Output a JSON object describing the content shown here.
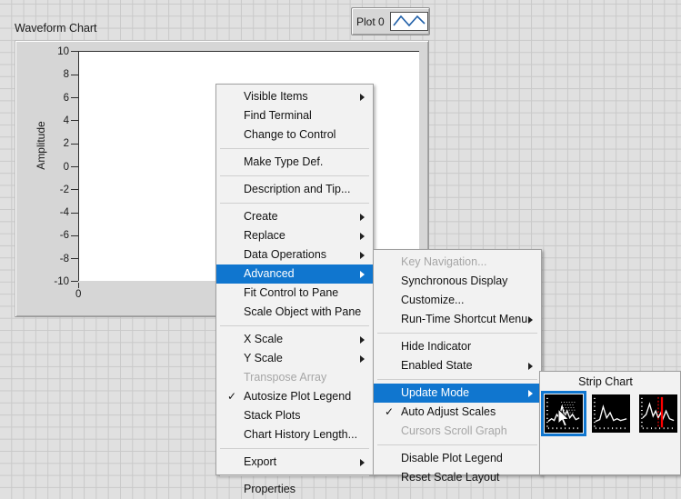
{
  "chart": {
    "label": "Waveform Chart",
    "y_axis_title": "Amplitude",
    "y_ticks": [
      "10",
      "8",
      "6",
      "4",
      "2",
      "0",
      "-2",
      "-4",
      "-6",
      "-8",
      "-10"
    ],
    "x_ticks": [
      "0"
    ],
    "plot_background": "#ffffff",
    "frame_background": "#d6d6d6"
  },
  "plot_legend": {
    "label": "Plot 0",
    "swatch_icon": "waveform-line-icon",
    "line_color": "#1f5fa8"
  },
  "context_menu": {
    "items": [
      {
        "label": "Visible Items",
        "submenu": true
      },
      {
        "label": "Find Terminal",
        "submenu": false
      },
      {
        "label": "Change to Control",
        "submenu": false
      },
      {
        "separator": true
      },
      {
        "label": "Make Type Def.",
        "submenu": false
      },
      {
        "separator": true
      },
      {
        "label": "Description and Tip...",
        "submenu": false
      },
      {
        "separator": true
      },
      {
        "label": "Create",
        "submenu": true
      },
      {
        "label": "Replace",
        "submenu": true
      },
      {
        "label": "Data Operations",
        "submenu": true
      },
      {
        "label": "Advanced",
        "submenu": true,
        "highlighted": true
      },
      {
        "label": "Fit Control to Pane",
        "submenu": false
      },
      {
        "label": "Scale Object with Pane",
        "submenu": false
      },
      {
        "separator": true
      },
      {
        "label": "X Scale",
        "submenu": true
      },
      {
        "label": "Y Scale",
        "submenu": true
      },
      {
        "label": "Transpose Array",
        "submenu": false,
        "disabled": true
      },
      {
        "label": "Autosize Plot Legend",
        "submenu": false,
        "checked": true
      },
      {
        "label": "Stack Plots",
        "submenu": false
      },
      {
        "label": "Chart History Length...",
        "submenu": false
      },
      {
        "separator": true
      },
      {
        "label": "Export",
        "submenu": true
      },
      {
        "separator": true
      },
      {
        "label": "Properties",
        "submenu": false
      }
    ]
  },
  "advanced_submenu": {
    "items": [
      {
        "label": "Key Navigation...",
        "submenu": false,
        "disabled": true
      },
      {
        "label": "Synchronous Display",
        "submenu": false
      },
      {
        "label": "Customize...",
        "submenu": false
      },
      {
        "label": "Run-Time Shortcut Menu",
        "submenu": true
      },
      {
        "separator": true
      },
      {
        "label": "Hide Indicator",
        "submenu": false
      },
      {
        "label": "Enabled State",
        "submenu": true
      },
      {
        "separator": true
      },
      {
        "label": "Update Mode",
        "submenu": true,
        "highlighted": true
      },
      {
        "label": "Auto Adjust Scales",
        "submenu": false,
        "checked": true
      },
      {
        "label": "Cursors Scroll Graph",
        "submenu": false,
        "disabled": true
      },
      {
        "separator": true
      },
      {
        "label": "Disable Plot Legend",
        "submenu": false
      },
      {
        "label": "Reset Scale Layout",
        "submenu": false
      }
    ]
  },
  "update_mode_popup": {
    "title": "Strip Chart",
    "options": [
      {
        "name": "strip-chart-icon",
        "selected": true
      },
      {
        "name": "scope-chart-icon",
        "selected": false
      },
      {
        "name": "sweep-chart-icon",
        "selected": false
      }
    ],
    "selection_color": "#1076cf",
    "sweep_line_color": "#ff0000"
  },
  "colors": {
    "highlight": "#1076cf",
    "menu_background": "#f2f2f2",
    "panel_background": "#e0e0e0",
    "grid_line": "#c9c9c9"
  }
}
